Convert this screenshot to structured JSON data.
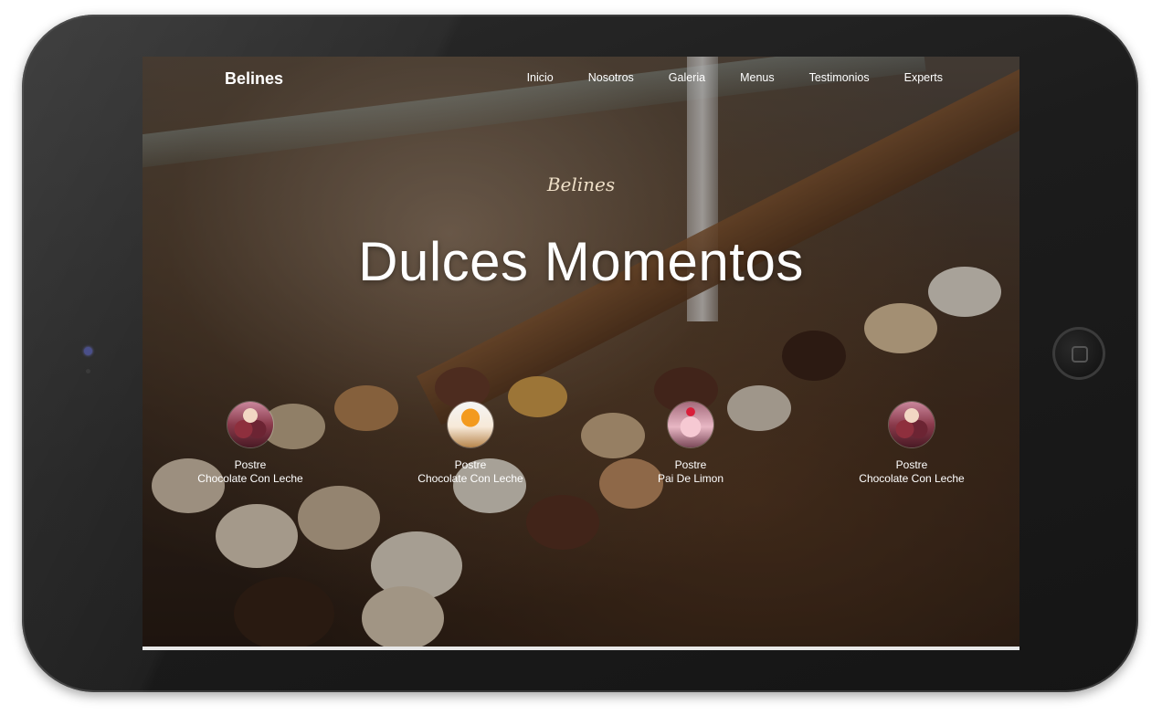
{
  "site": {
    "brand": "Belines",
    "script_brand": "Belines",
    "hero_title": "Dulces Momentos"
  },
  "nav": {
    "items": [
      {
        "label": "Inicio"
      },
      {
        "label": "Nosotros"
      },
      {
        "label": "Galeria"
      },
      {
        "label": "Menus"
      },
      {
        "label": "Testimonios"
      },
      {
        "label": "Experts"
      }
    ]
  },
  "products": [
    {
      "category": "Postre",
      "name": "Chocolate Con Leche",
      "thumb": "chocolate-dessert-image"
    },
    {
      "category": "Postre",
      "name": "Chocolate Con Leche",
      "thumb": "orange-dessert-image"
    },
    {
      "category": "Postre",
      "name": "Pai De Limon",
      "thumb": "strawberry-dessert-image"
    },
    {
      "category": "Postre",
      "name": "Chocolate Con Leche",
      "thumb": "chocolate-dessert-image"
    }
  ],
  "colors": {
    "text": "#ffffff",
    "device_frame": "#1c1c1c"
  }
}
